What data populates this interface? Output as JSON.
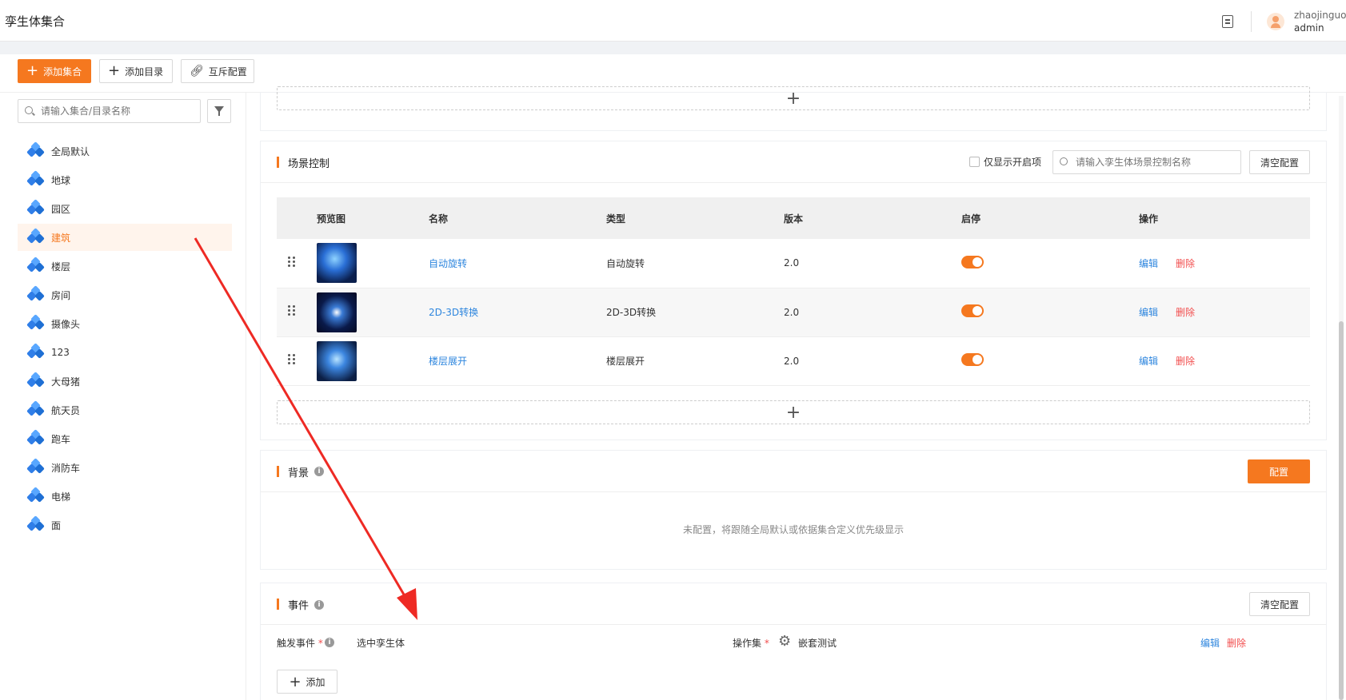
{
  "header": {
    "title": "孪生体集合",
    "user_name": "zhaojinguo",
    "user_role": "admin"
  },
  "toolbar": {
    "add_collection": "添加集合",
    "add_directory": "添加目录",
    "mutex_config": "互斥配置"
  },
  "sidebar": {
    "search_placeholder": "请输入集合/目录名称",
    "items": [
      {
        "label": "全局默认"
      },
      {
        "label": "地球"
      },
      {
        "label": "园区"
      },
      {
        "label": "建筑",
        "active": true
      },
      {
        "label": "楼层"
      },
      {
        "label": "房间"
      },
      {
        "label": "摄像头"
      },
      {
        "label": "123"
      },
      {
        "label": "大母猪"
      },
      {
        "label": "航天员"
      },
      {
        "label": "跑车"
      },
      {
        "label": "消防车"
      },
      {
        "label": "电梯"
      },
      {
        "label": "面"
      }
    ]
  },
  "scene": {
    "title": "场景控制",
    "only_enabled_label": "仅显示开启项",
    "search_placeholder": "请输入孪生体场景控制名称",
    "clear_label": "清空配置",
    "columns": [
      "预览图",
      "名称",
      "类型",
      "版本",
      "启停",
      "操作"
    ],
    "rows": [
      {
        "name": "自动旋转",
        "type": "自动旋转",
        "version": "2.0",
        "enabled": true,
        "edit": "编辑",
        "delete": "删除"
      },
      {
        "name": "2D-3D转换",
        "type": "2D-3D转换",
        "version": "2.0",
        "enabled": true,
        "edit": "编辑",
        "delete": "删除"
      },
      {
        "name": "楼层展开",
        "type": "楼层展开",
        "version": "2.0",
        "enabled": true,
        "edit": "编辑",
        "delete": "删除"
      }
    ]
  },
  "background": {
    "title": "背景",
    "config_label": "配置",
    "empty_text": "未配置，将跟随全局默认或依据集合定义优先级显示"
  },
  "events": {
    "title": "事件",
    "clear_label": "清空配置",
    "trigger_label": "触发事件",
    "trigger_value": "选中孪生体",
    "action_label": "操作集",
    "action_value": "嵌套测试",
    "edit": "编辑",
    "delete": "删除",
    "add_label": "添加"
  },
  "colors": {
    "accent": "#f5781f",
    "link": "#2e86de",
    "danger": "#f24e4e",
    "annotation_arrow": "#ee2a24"
  }
}
